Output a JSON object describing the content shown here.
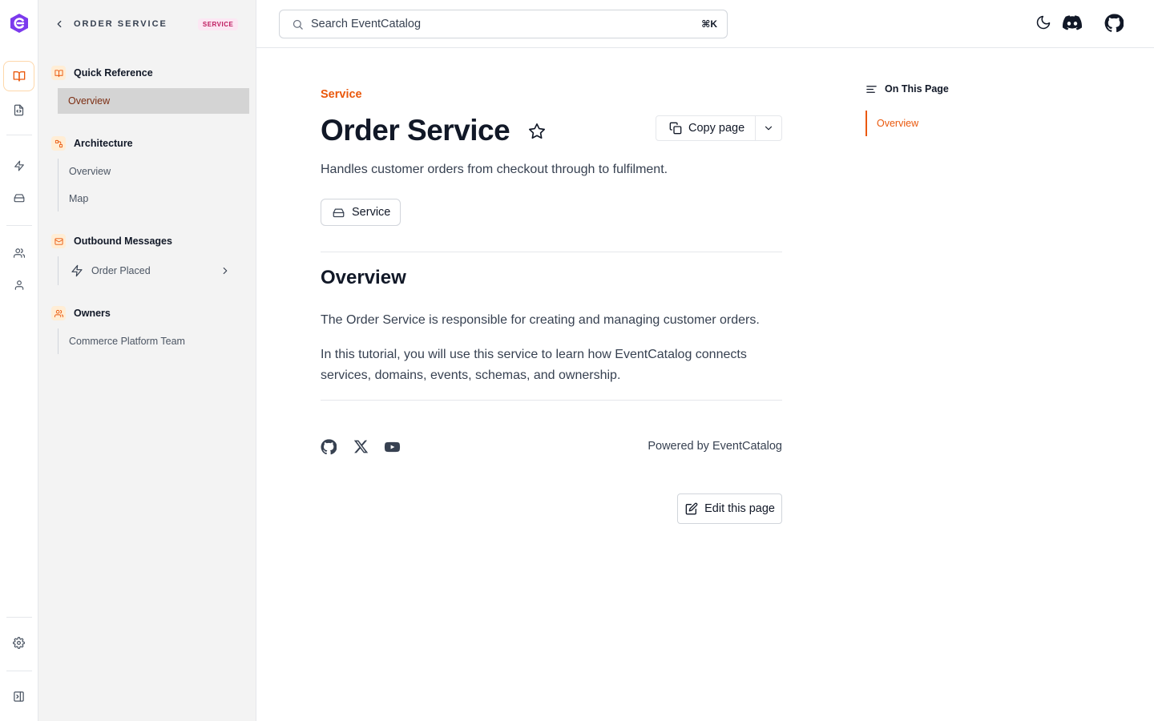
{
  "sidebar": {
    "title": "ORDER SERVICE",
    "badge": "SERVICE",
    "sections": [
      {
        "label": "Quick Reference",
        "icon": "book-icon",
        "items": [
          {
            "label": "Overview",
            "active": true
          }
        ]
      },
      {
        "label": "Architecture",
        "icon": "architecture-icon",
        "items": [
          {
            "label": "Overview"
          },
          {
            "label": "Map"
          }
        ]
      },
      {
        "label": "Outbound Messages",
        "icon": "mail-icon",
        "items": [
          {
            "label": "Order Placed",
            "icon": "bolt-icon"
          }
        ]
      },
      {
        "label": "Owners",
        "icon": "users-icon",
        "items": [
          {
            "label": "Commerce Platform Team"
          }
        ]
      }
    ]
  },
  "header": {
    "search_placeholder": "Search EventCatalog",
    "shortcut": "⌘K"
  },
  "main": {
    "eyebrow": "Service",
    "title": "Order Service",
    "copy_label": "Copy page",
    "summary": "Handles customer orders from checkout through to fulfilment.",
    "tag": "Service",
    "overview_heading": "Overview",
    "paragraph1": "The Order Service is responsible for creating and managing customer orders.",
    "paragraph2": "In this tutorial, you will use this service to learn how EventCatalog connects services, domains, events, schemas, and ownership.",
    "powered_by": "Powered by EventCatalog",
    "edit_label": "Edit this page"
  },
  "toc": {
    "heading": "On This Page",
    "items": [
      "Overview"
    ]
  },
  "colors": {
    "accent": "#ea580c",
    "badge_text": "#be185d",
    "badge_bg": "#fce7f3",
    "logo": "#7c3aed"
  }
}
